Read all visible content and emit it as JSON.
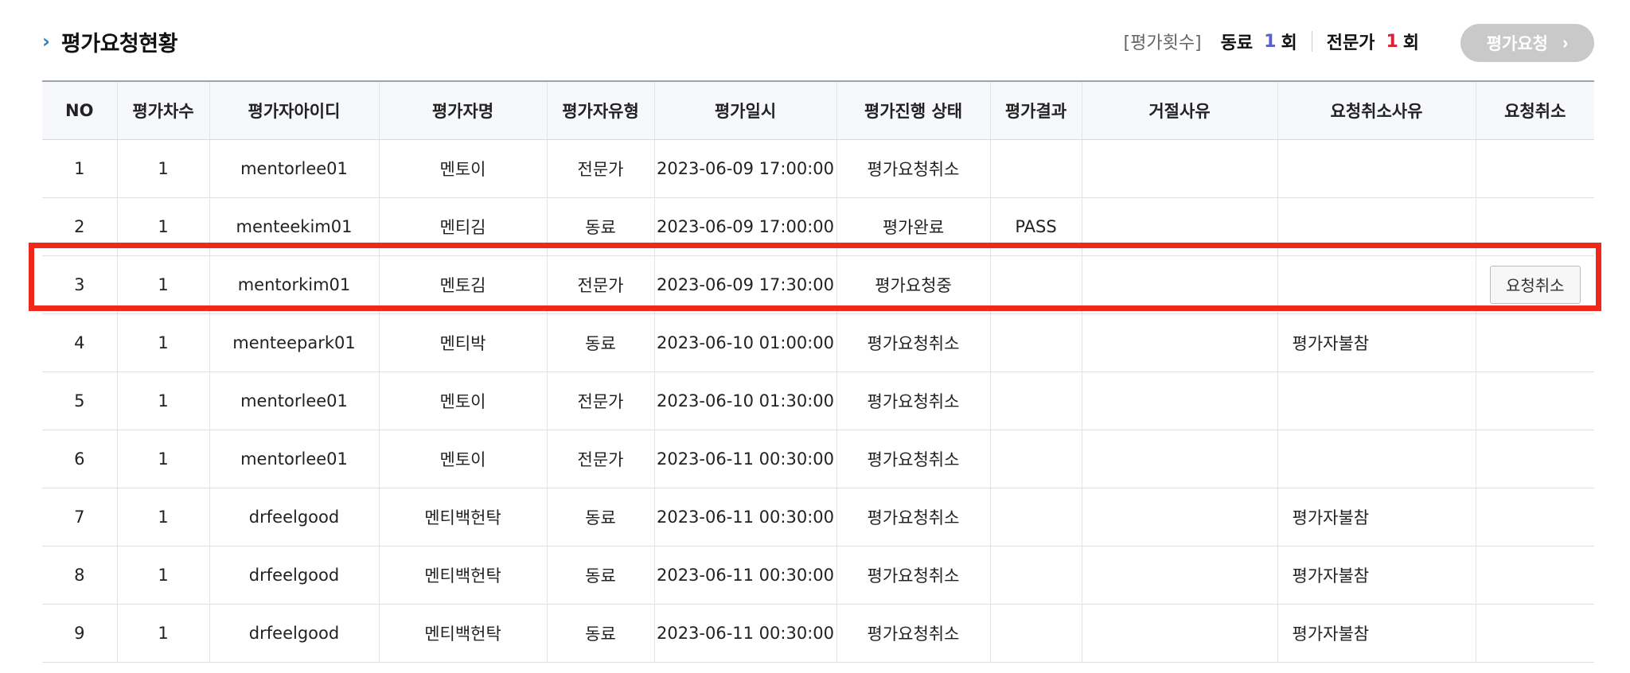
{
  "header": {
    "title": "평가요청현황",
    "count_label": "[평가횟수]",
    "peer_label": "동료",
    "peer_count": "1",
    "expert_label": "전문가",
    "expert_count": "1",
    "unit": "회",
    "request_button_label": "평가요청"
  },
  "table": {
    "columns": [
      "NO",
      "평가차수",
      "평가자아이디",
      "평가자명",
      "평가자유형",
      "평가일시",
      "평가진행 상태",
      "평가결과",
      "거절사유",
      "요청취소사유",
      "요청취소"
    ],
    "rows": [
      {
        "no": "1",
        "round": "1",
        "id": "mentorlee01",
        "name": "멘토이",
        "type": "전문가",
        "datetime": "2023-06-09 17:00:00",
        "status": "평가요청취소",
        "result": "",
        "reject_reason": "",
        "cancel_reason": "",
        "cancel_button": ""
      },
      {
        "no": "2",
        "round": "1",
        "id": "menteekim01",
        "name": "멘티김",
        "type": "동료",
        "datetime": "2023-06-09 17:00:00",
        "status": "평가완료",
        "result": "PASS",
        "reject_reason": "",
        "cancel_reason": "",
        "cancel_button": ""
      },
      {
        "no": "3",
        "round": "1",
        "id": "mentorkim01",
        "name": "멘토김",
        "type": "전문가",
        "datetime": "2023-06-09 17:30:00",
        "status": "평가요청중",
        "result": "",
        "reject_reason": "",
        "cancel_reason": "",
        "cancel_button": "요청취소"
      },
      {
        "no": "4",
        "round": "1",
        "id": "menteepark01",
        "name": "멘티박",
        "type": "동료",
        "datetime": "2023-06-10 01:00:00",
        "status": "평가요청취소",
        "result": "",
        "reject_reason": "",
        "cancel_reason": "평가자불참",
        "cancel_button": ""
      },
      {
        "no": "5",
        "round": "1",
        "id": "mentorlee01",
        "name": "멘토이",
        "type": "전문가",
        "datetime": "2023-06-10 01:30:00",
        "status": "평가요청취소",
        "result": "",
        "reject_reason": "",
        "cancel_reason": "",
        "cancel_button": ""
      },
      {
        "no": "6",
        "round": "1",
        "id": "mentorlee01",
        "name": "멘토이",
        "type": "전문가",
        "datetime": "2023-06-11 00:30:00",
        "status": "평가요청취소",
        "result": "",
        "reject_reason": "",
        "cancel_reason": "",
        "cancel_button": ""
      },
      {
        "no": "7",
        "round": "1",
        "id": "drfeelgood",
        "name": "멘티백헌탁",
        "type": "동료",
        "datetime": "2023-06-11 00:30:00",
        "status": "평가요청취소",
        "result": "",
        "reject_reason": "",
        "cancel_reason": "평가자불참",
        "cancel_button": ""
      },
      {
        "no": "8",
        "round": "1",
        "id": "drfeelgood",
        "name": "멘티백헌탁",
        "type": "동료",
        "datetime": "2023-06-11 00:30:00",
        "status": "평가요청취소",
        "result": "",
        "reject_reason": "",
        "cancel_reason": "평가자불참",
        "cancel_button": ""
      },
      {
        "no": "9",
        "round": "1",
        "id": "drfeelgood",
        "name": "멘티백헌탁",
        "type": "동료",
        "datetime": "2023-06-11 00:30:00",
        "status": "평가요청취소",
        "result": "",
        "reject_reason": "",
        "cancel_reason": "평가자불참",
        "cancel_button": ""
      }
    ]
  },
  "colors": {
    "accent": "#2f7fc0",
    "peer_count_color": "#5a5fd6",
    "expert_count_color": "#d8233a",
    "highlight": "#f0281a",
    "disabled_button": "#c9c9c9"
  }
}
